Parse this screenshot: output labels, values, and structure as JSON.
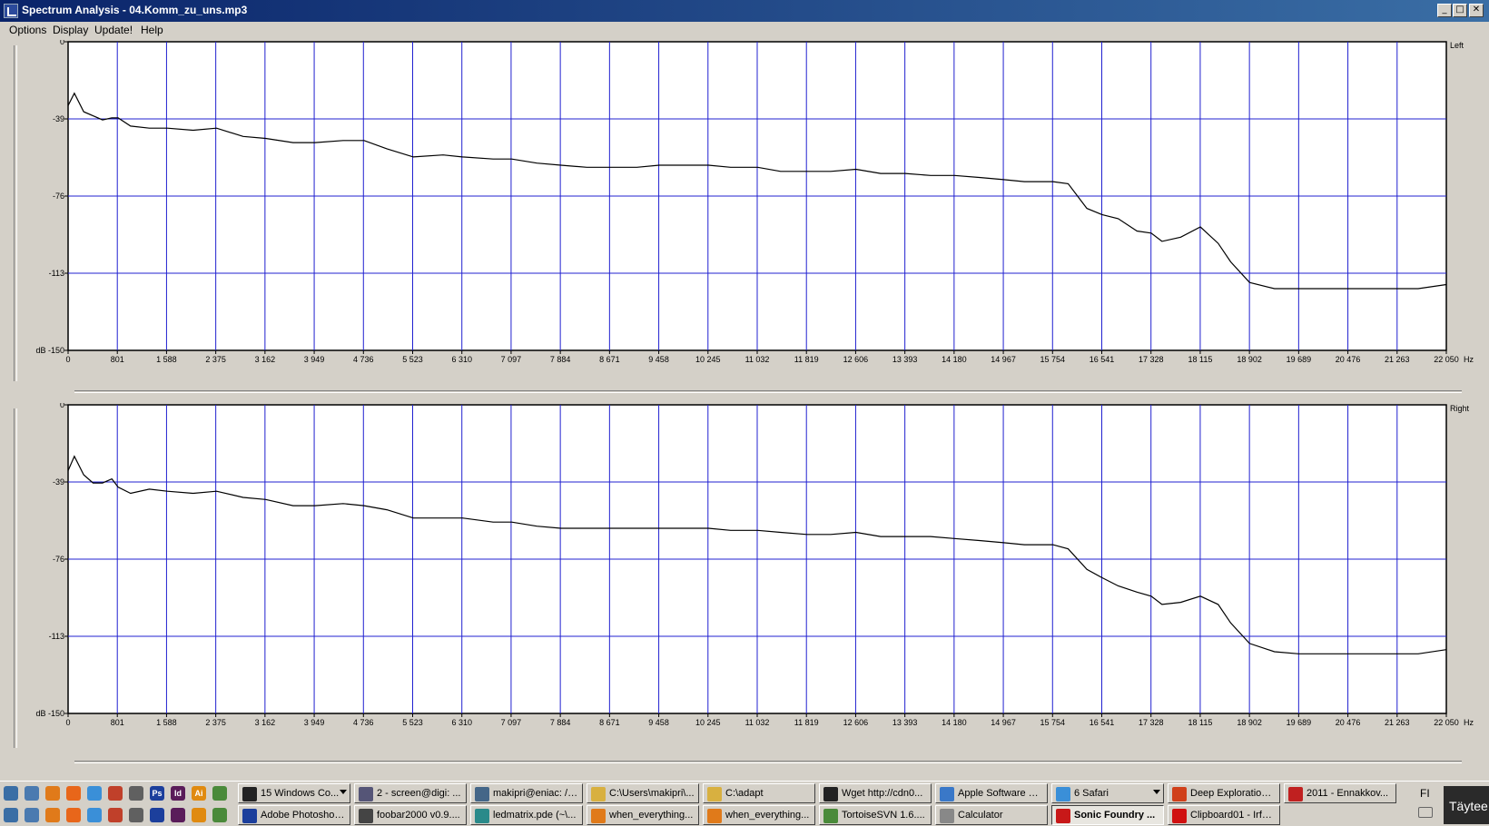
{
  "window": {
    "title": "Spectrum Analysis - 04.Komm_zu_uns.mp3",
    "controls": [
      "minimize",
      "maximize",
      "close"
    ]
  },
  "menu": [
    "Options",
    "Display",
    "Update!",
    "Help"
  ],
  "chart_data": [
    {
      "type": "line",
      "title": "Left",
      "xlabel": "Hz",
      "ylabel": "dB",
      "ylim": [
        -150,
        0
      ],
      "xlim": [
        0,
        22050
      ],
      "yticks": [
        "0",
        "-39",
        "-76",
        "-113",
        "dB -150"
      ],
      "xticks": [
        "0",
        "801",
        "1 588",
        "2 375",
        "3 162",
        "3 949",
        "4 736",
        "5 523",
        "6 310",
        "7 097",
        "7 884",
        "8 671",
        "9 458",
        "10 245",
        "11 032",
        "11 819",
        "12 606",
        "13 393",
        "14 180",
        "14 967",
        "15 754",
        "16 541",
        "17 328",
        "18 115",
        "18 902",
        "19 689",
        "20 476",
        "21 263",
        "22 050"
      ],
      "grid": true,
      "series": [
        {
          "x": [
            0,
            100,
            250,
            400,
            550,
            700,
            801,
            1000,
            1300,
            1588,
            2000,
            2375,
            2800,
            3162,
            3600,
            3949,
            4400,
            4736,
            5100,
            5523,
            6000,
            6310,
            6800,
            7097,
            7500,
            7884,
            8300,
            8671,
            9100,
            9458,
            9900,
            10245,
            10600,
            11032,
            11400,
            11819,
            12200,
            12606,
            13000,
            13393,
            13800,
            14180,
            14600,
            14967,
            15300,
            15754,
            16000,
            16300,
            16541,
            16800,
            17100,
            17328,
            17500,
            17800,
            18115,
            18400,
            18600,
            18902,
            19300,
            19689,
            20100,
            20476,
            20900,
            21263,
            21600,
            22050
          ],
          "y": [
            -31,
            -25,
            -34,
            -36,
            -38,
            -37,
            -37,
            -41,
            -42,
            -42,
            -43,
            -42,
            -46,
            -47,
            -49,
            -49,
            -48,
            -48,
            -52,
            -56,
            -55,
            -56,
            -57,
            -57,
            -59,
            -60,
            -61,
            -61,
            -61,
            -60,
            -60,
            -60,
            -61,
            -61,
            -63,
            -63,
            -63,
            -62,
            -64,
            -64,
            -65,
            -65,
            -66,
            -67,
            -68,
            -68,
            -69,
            -81,
            -84,
            -86,
            -92,
            -93,
            -97,
            -95,
            -90,
            -98,
            -107,
            -117,
            -120,
            -120,
            -120,
            -120,
            -120,
            -120,
            -120,
            -118
          ]
        }
      ]
    },
    {
      "type": "line",
      "title": "Right",
      "xlabel": "Hz",
      "ylabel": "dB",
      "ylim": [
        -150,
        0
      ],
      "xlim": [
        0,
        22050
      ],
      "yticks": [
        "0",
        "-39",
        "-76",
        "-113",
        "dB -150"
      ],
      "xticks": [
        "0",
        "801",
        "1 588",
        "2 375",
        "3 162",
        "3 949",
        "4 736",
        "5 523",
        "6 310",
        "7 097",
        "7 884",
        "8 671",
        "9 458",
        "10 245",
        "11 032",
        "11 819",
        "12 606",
        "13 393",
        "14 180",
        "14 967",
        "15 754",
        "16 541",
        "17 328",
        "18 115",
        "18 902",
        "19 689",
        "20 476",
        "21 263",
        "22 050"
      ],
      "grid": true,
      "series": [
        {
          "x": [
            0,
            100,
            250,
            400,
            550,
            700,
            801,
            1000,
            1300,
            1588,
            2000,
            2375,
            2800,
            3162,
            3600,
            3949,
            4400,
            4736,
            5100,
            5523,
            6000,
            6310,
            6800,
            7097,
            7500,
            7884,
            8300,
            8671,
            9100,
            9458,
            9900,
            10245,
            10600,
            11032,
            11400,
            11819,
            12200,
            12606,
            13000,
            13393,
            13800,
            14180,
            14600,
            14967,
            15300,
            15754,
            16000,
            16300,
            16541,
            16800,
            17100,
            17328,
            17500,
            17800,
            18115,
            18400,
            18600,
            18902,
            19300,
            19689,
            20100,
            20476,
            20900,
            21263,
            21600,
            22050
          ],
          "y": [
            -32,
            -25,
            -34,
            -38,
            -38,
            -36,
            -40,
            -43,
            -41,
            -42,
            -43,
            -42,
            -45,
            -46,
            -49,
            -49,
            -48,
            -49,
            -51,
            -55,
            -55,
            -55,
            -57,
            -57,
            -59,
            -60,
            -60,
            -60,
            -60,
            -60,
            -60,
            -60,
            -61,
            -61,
            -62,
            -63,
            -63,
            -62,
            -64,
            -64,
            -64,
            -65,
            -66,
            -67,
            -68,
            -68,
            -70,
            -80,
            -84,
            -88,
            -91,
            -93,
            -97,
            -96,
            -93,
            -97,
            -106,
            -116,
            -120,
            -121,
            -121,
            -121,
            -121,
            -121,
            -121,
            -119
          ]
        }
      ]
    }
  ],
  "taskbar": {
    "quick_launch_row1": [
      "show-desktop-icon",
      "network-icon",
      "blender-icon",
      "firefox-icon",
      "chrome-icon",
      "filezilla-icon",
      "inkscape-icon",
      "photoshop-icon",
      "indesign-icon",
      "illustrator-icon",
      "tortoise-icon"
    ],
    "quick_launch_row2": [
      "explorer-icon",
      "ie-icon",
      "blender2-icon",
      "black-circle-icon",
      "folder-icon",
      "vnc-icon",
      "opera-icon",
      "globe-icon",
      "camera-icon",
      "settings-icon",
      "safari-icon"
    ],
    "quick_launch_labels": {
      "photoshop": "Ps",
      "indesign": "Id",
      "illustrator": "Ai"
    },
    "row1": [
      {
        "label": "15 Windows Co...",
        "icon": "cmd-icon",
        "group": true,
        "count": "15"
      },
      {
        "label": "2 - screen@digi: ...",
        "icon": "terminal-icon",
        "group": false
      },
      {
        "label": "makipri@eniac: /h...",
        "icon": "ssh-icon",
        "group": false
      },
      {
        "label": "C:\\Users\\makipri\\...",
        "icon": "folder-icon",
        "group": false
      },
      {
        "label": "C:\\adapt",
        "icon": "folder-icon",
        "group": false
      },
      {
        "label": "Wget http://cdn0...",
        "icon": "cmd-icon",
        "group": false
      },
      {
        "label": "Apple Software U...",
        "icon": "apple-update-icon",
        "group": false
      },
      {
        "label": "6 Safari",
        "icon": "safari-icon",
        "group": true,
        "count": "6"
      },
      {
        "label": "Deep Exploration ...",
        "icon": "deep-exploration-icon",
        "group": false
      },
      {
        "label": "2011 - Ennakkov...",
        "icon": "pdf-icon",
        "group": false
      }
    ],
    "row2": [
      {
        "label": "Adobe Photoshop...",
        "icon": "photoshop-icon",
        "active": false
      },
      {
        "label": "foobar2000 v0.9....",
        "icon": "foobar-icon",
        "active": false
      },
      {
        "label": "ledmatrix.pde (~\\...",
        "icon": "arduino-icon",
        "active": false
      },
      {
        "label": "when_everything...",
        "icon": "blender-icon",
        "active": false
      },
      {
        "label": "when_everything...",
        "icon": "blender-icon",
        "active": false
      },
      {
        "label": "TortoiseSVN 1.6....",
        "icon": "tortoise-icon",
        "active": false
      },
      {
        "label": "Calculator",
        "icon": "calculator-icon",
        "active": false
      },
      {
        "label": "Sonic Foundry ...",
        "icon": "sonic-foundry-icon",
        "active": true
      },
      {
        "label": "Clipboard01 - Irfa...",
        "icon": "irfanview-icon",
        "active": false
      }
    ],
    "language": "FI",
    "notification": "Täytee"
  }
}
